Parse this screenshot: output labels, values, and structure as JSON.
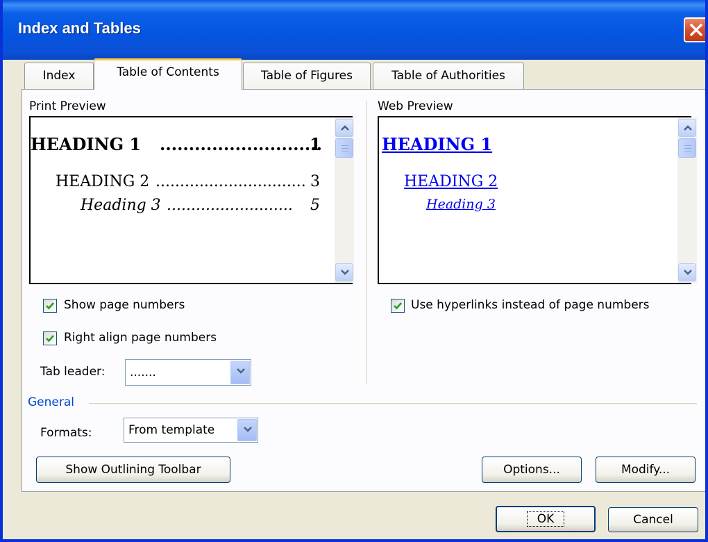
{
  "window": {
    "title": "Index and Tables"
  },
  "tabs": [
    {
      "label": "Index"
    },
    {
      "label": "Table of Contents"
    },
    {
      "label": "Table of Figures"
    },
    {
      "label": "Table of Authorities"
    }
  ],
  "print_preview": {
    "label": "Print Preview",
    "entries": [
      {
        "text": "HEADING 1",
        "leader": "............................",
        "page": "1"
      },
      {
        "text": "HEADING 2",
        "leader": "...............................",
        "page": "3"
      },
      {
        "text": "Heading 3",
        "leader": "..........................",
        "page": "5"
      }
    ]
  },
  "web_preview": {
    "label": "Web Preview",
    "entries": [
      {
        "text": "HEADING 1"
      },
      {
        "text": "HEADING 2"
      },
      {
        "text": "Heading 3"
      }
    ]
  },
  "options": {
    "show_page_numbers": {
      "label": "Show page numbers",
      "checked": true
    },
    "right_align": {
      "label": "Right align page numbers",
      "checked": true
    },
    "use_hyperlinks": {
      "label": "Use hyperlinks instead of page numbers",
      "checked": true
    },
    "tab_leader_label": "Tab leader:",
    "tab_leader_value": ".......",
    "general_label": "General",
    "formats_label": "Formats:",
    "formats_value": "From template"
  },
  "buttons": {
    "outlining": "Show Outlining Toolbar",
    "options": "Options...",
    "modify": "Modify...",
    "ok": "OK",
    "cancel": "Cancel"
  },
  "colors": {
    "titlebar": "#0554e0",
    "dialog_bg": "#ece9d8",
    "link_blue": "#0000ee",
    "general_blue": "#0046d5",
    "active_tab_accent": "#ffc83c"
  }
}
